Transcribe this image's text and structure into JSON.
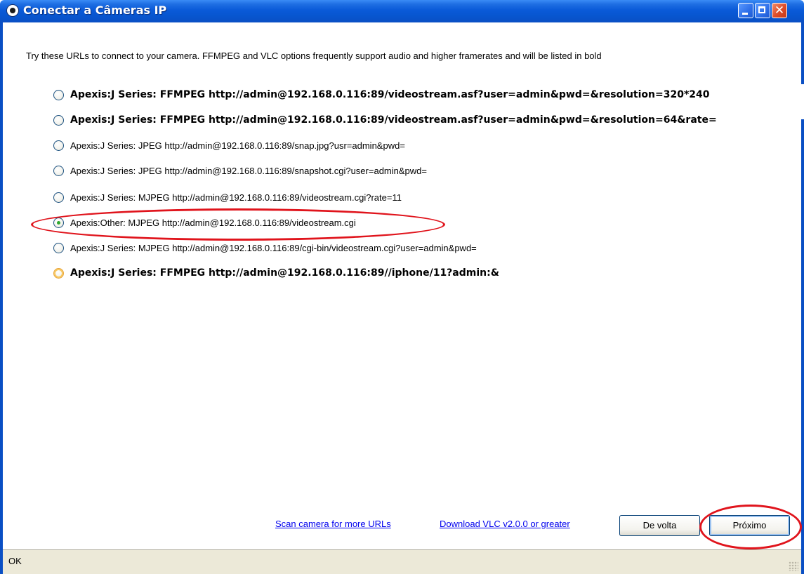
{
  "window": {
    "title": "Conectar a Câmeras IP",
    "close_glyph": "✕"
  },
  "intro_text": "Try these URLs to connect to your camera. FFMPEG and VLC options frequently support audio and higher framerates and will be listed in bold",
  "options": [
    {
      "label": "Apexis:J Series: FFMPEG http://admin@192.168.0.116:89/videostream.asf?user=admin&pwd=&resolution=320*240",
      "bold": true,
      "checked": false
    },
    {
      "label": "Apexis:J Series: FFMPEG http://admin@192.168.0.116:89/videostream.asf?user=admin&pwd=&resolution=64&rate=",
      "bold": true,
      "checked": false
    },
    {
      "label": "Apexis:J Series: JPEG http://admin@192.168.0.116:89/snap.jpg?usr=admin&pwd=",
      "bold": false,
      "checked": false
    },
    {
      "label": "Apexis:J Series: JPEG http://admin@192.168.0.116:89/snapshot.cgi?user=admin&pwd=",
      "bold": false,
      "checked": false
    },
    {
      "label": "Apexis:J Series: MJPEG http://admin@192.168.0.116:89/videostream.cgi?rate=11",
      "bold": false,
      "checked": false
    },
    {
      "label": "Apexis:Other: MJPEG http://admin@192.168.0.116:89/videostream.cgi",
      "bold": false,
      "checked": true
    },
    {
      "label": "Apexis:J Series: MJPEG http://admin@192.168.0.116:89/cgi-bin/videostream.cgi?user=admin&pwd=",
      "bold": false,
      "checked": false
    },
    {
      "label": "Apexis:J Series: FFMPEG http://admin@192.168.0.116:89//iphone/11?admin:&",
      "bold": true,
      "checked": false
    }
  ],
  "links": {
    "scan": "Scan camera for more URLs",
    "download_vlc": "Download VLC v2.0.0 or greater"
  },
  "buttons": {
    "back": "De volta",
    "next": "Próximo"
  },
  "status": {
    "text": "OK"
  },
  "colors": {
    "annotation": "#e0141c",
    "titlebar": "#0a5ad8",
    "link": "#0000ee"
  }
}
